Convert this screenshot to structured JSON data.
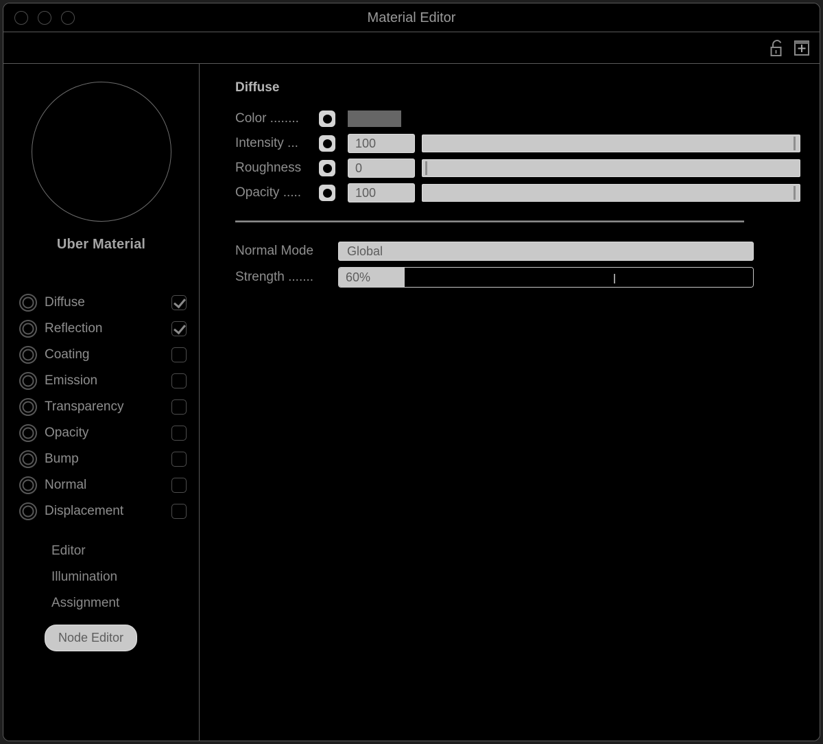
{
  "window": {
    "title": "Material Editor",
    "traffic_lights": [
      "close-button",
      "minimize-button",
      "zoom-button"
    ]
  },
  "toolbar": {
    "icons": [
      {
        "name": "unlock-icon",
        "label": "Unlock"
      },
      {
        "name": "add-box-icon",
        "label": "Add"
      }
    ]
  },
  "sidebar": {
    "preview": {
      "name": "material-preview-sphere"
    },
    "material_name": "Uber Material",
    "channels": [
      {
        "label": "Diffuse",
        "checked": true
      },
      {
        "label": "Reflection",
        "checked": true
      },
      {
        "label": "Coating",
        "checked": false
      },
      {
        "label": "Emission",
        "checked": false
      },
      {
        "label": "Transparency",
        "checked": false
      },
      {
        "label": "Opacity",
        "checked": false
      },
      {
        "label": "Bump",
        "checked": false
      },
      {
        "label": "Normal",
        "checked": false
      },
      {
        "label": "Displacement",
        "checked": false
      }
    ],
    "nav_links": [
      "Editor",
      "Illumination",
      "Assignment"
    ],
    "node_editor_button": "Node Editor"
  },
  "main": {
    "section_title": "Diffuse",
    "rows": [
      {
        "label": "Color ........",
        "type": "color",
        "swatch": "#666666"
      },
      {
        "label": "Intensity ...",
        "type": "slider",
        "value": "100",
        "percent": 100
      },
      {
        "label": "Roughness",
        "type": "slider",
        "value": "0",
        "percent": 0
      },
      {
        "label": "Opacity .....",
        "type": "slider",
        "value": "100",
        "percent": 100
      }
    ],
    "normal_mode": {
      "label": "Normal Mode",
      "value": "Global"
    },
    "strength": {
      "label": "Strength .......",
      "value": "60%",
      "percent": 60
    }
  },
  "colors": {
    "background": "#000000",
    "border": "#5a5a5a",
    "text": "#8e8e8e",
    "field": "#c9c9c9",
    "swatch": "#666666"
  }
}
